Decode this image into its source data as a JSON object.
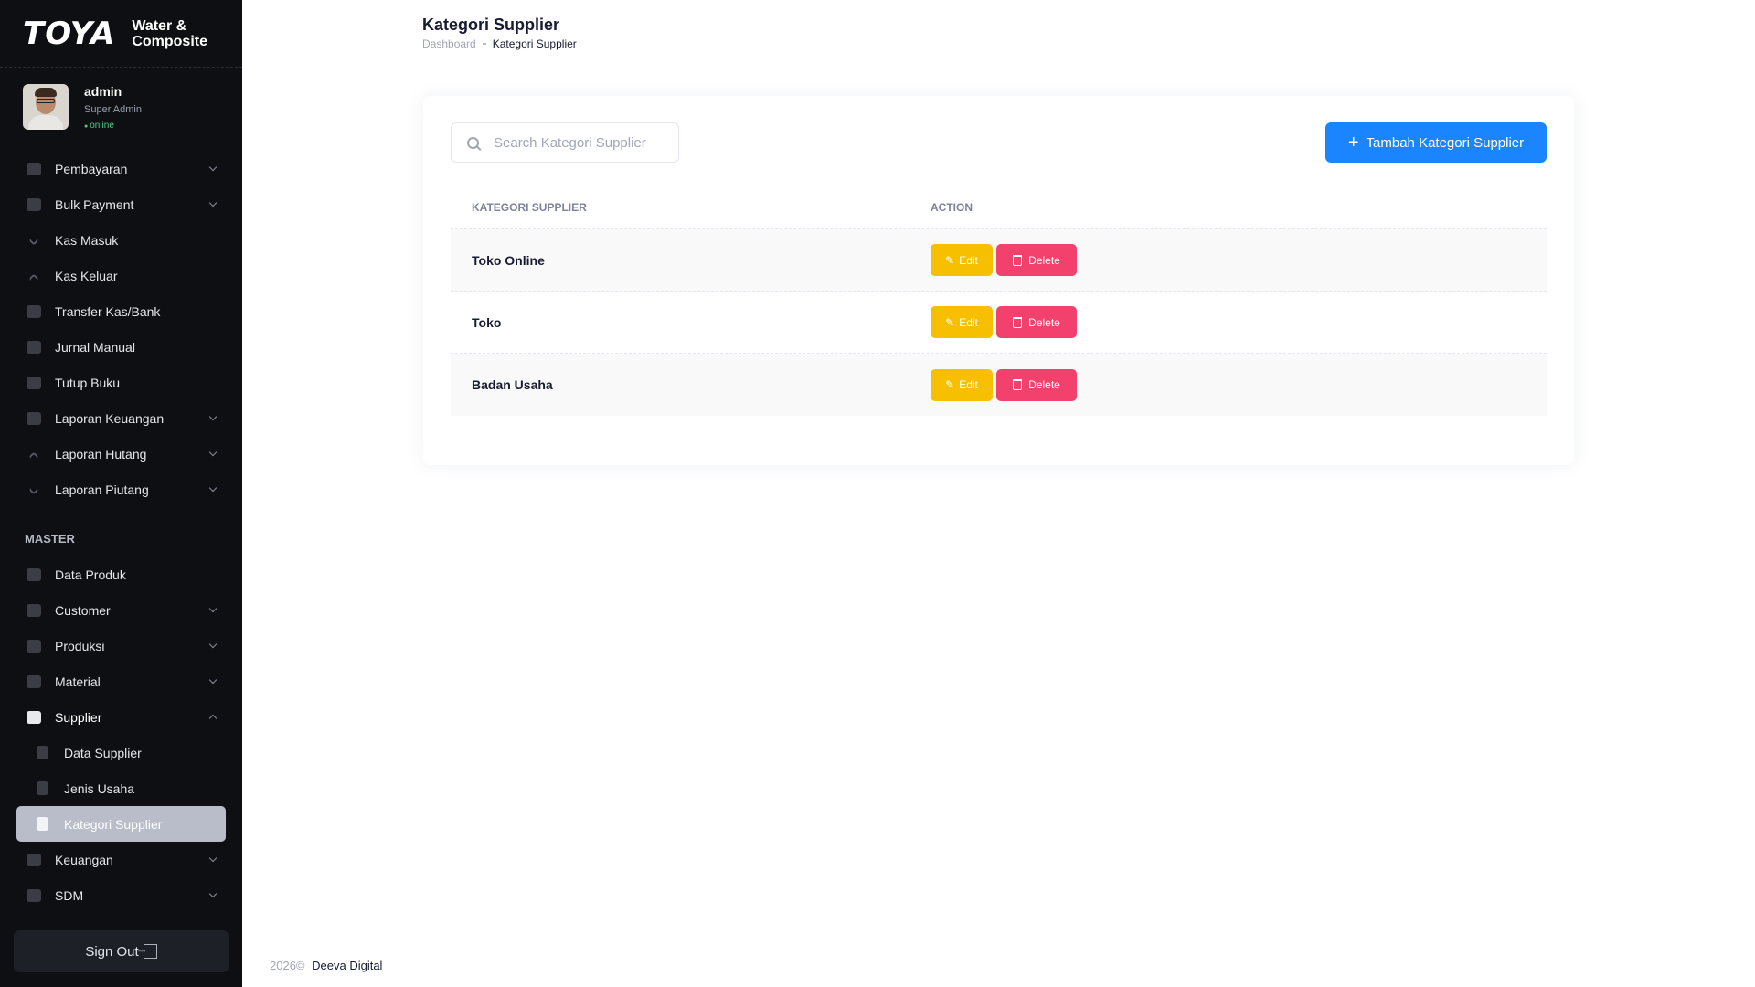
{
  "brand": {
    "logo": "TOYA",
    "subtitle_line1": "Water &",
    "subtitle_line2": "Composite"
  },
  "user": {
    "name": "admin",
    "role": "Super Admin",
    "status": "online"
  },
  "sidebar": {
    "items": [
      {
        "label": "Pembayaran",
        "icon": "payment-icon",
        "has_arrow": true
      },
      {
        "label": "Bulk Payment",
        "icon": "wallet-icon",
        "has_arrow": true
      },
      {
        "label": "Kas Masuk",
        "icon": "chevron-down-icon",
        "has_arrow": false
      },
      {
        "label": "Kas Keluar",
        "icon": "chevron-up-icon",
        "has_arrow": false
      },
      {
        "label": "Transfer Kas/Bank",
        "icon": "toggle-icon",
        "has_arrow": false
      },
      {
        "label": "Jurnal Manual",
        "icon": "document-icon",
        "has_arrow": false
      },
      {
        "label": "Tutup Buku",
        "icon": "calendar-icon",
        "has_arrow": false
      },
      {
        "label": "Laporan Keuangan",
        "icon": "chart-icon",
        "has_arrow": true
      },
      {
        "label": "Laporan Hutang",
        "icon": "chevron-up-icon",
        "has_arrow": true
      },
      {
        "label": "Laporan Piutang",
        "icon": "chevron-down-icon",
        "has_arrow": true
      }
    ],
    "section_master": "MASTER",
    "master_items": [
      {
        "label": "Data Produk",
        "has_arrow": false
      },
      {
        "label": "Customer",
        "has_arrow": true
      },
      {
        "label": "Produksi",
        "has_arrow": true
      },
      {
        "label": "Material",
        "has_arrow": true
      },
      {
        "label": "Supplier",
        "has_arrow": true
      }
    ],
    "supplier_sub": [
      {
        "label": "Data Supplier"
      },
      {
        "label": "Jenis Usaha"
      },
      {
        "label": "Kategori Supplier"
      }
    ],
    "bottom_items": [
      {
        "label": "Keuangan",
        "has_arrow": true
      },
      {
        "label": "SDM",
        "has_arrow": true
      }
    ],
    "signout_label": "Sign Out"
  },
  "header": {
    "title": "Kategori Supplier",
    "breadcrumb_home": "Dashboard",
    "breadcrumb_current": "Kategori Supplier"
  },
  "main": {
    "search_placeholder": "Search Kategori Supplier",
    "add_button_label": "Tambah Kategori Supplier",
    "table": {
      "columns": [
        "KATEGORI SUPPLIER",
        "ACTION"
      ],
      "rows": [
        {
          "name": "Toko Online"
        },
        {
          "name": "Toko"
        },
        {
          "name": "Badan Usaha"
        }
      ],
      "edit_label": "Edit",
      "delete_label": "Delete"
    }
  },
  "footer": {
    "year": "2026©",
    "company": "Deeva Digital"
  },
  "colors": {
    "primary": "#1b84ff",
    "warning": "#f6c000",
    "danger": "#f1416c",
    "sidebar_bg": "#0e0f12"
  }
}
